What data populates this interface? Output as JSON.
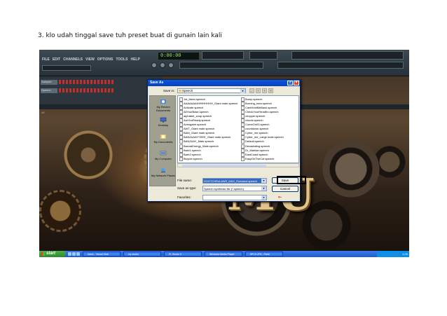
{
  "caption": "3. klo udah tinggal save tuh preset buat di gunain lain kali",
  "fl_studio": {
    "menu": [
      "FILE",
      "EDIT",
      "CHANNELS",
      "VIEW",
      "OPTIONS",
      "TOOLS",
      "HELP"
    ],
    "time_display": "0:00:00",
    "pattern_label": "Pattern 1",
    "channels": [
      "Sampler",
      "Speech"
    ],
    "browser_label": "All"
  },
  "dialog": {
    "title": "Save As",
    "save_in_label": "Save in:",
    "save_in_value": "Speech",
    "places": [
      "My Recent Documents",
      "Desktop",
      "My Documents",
      "My Computer",
      "My Network Places"
    ],
    "files_left": [
      "1st_listen.speech",
      "AAAAAAAHHHHHHHH_Giant male.speech",
      "Activate.speech",
      "AllYourBase.speech",
      "alphabet_soup.speech",
      "AreYouReady.speech",
      "Avengatre.speech",
      "AWT_Giant male.speech",
      "BAM_Giant male.speech",
      "BANZAAAYYEEE_Giant male.speech",
      "BANZAAY_Male.speech",
      "BanzaiEnergy_Male.speech",
      "Barb1.speech",
      "Barb2.speech",
      "Bicycle.speech"
    ],
    "files_right": [
      "Bump.speech",
      "Burning_ears.speech",
      "CantHoldMeBack.speech",
      "CheckYourHeadfro.speech",
      "chopper.speech",
      "clouds.speech",
      "ComeOn03.speech",
      "countdown.speech",
      "Cyber_me.speech",
      "Cyber_me_Large male.speech",
      "Default.speech",
      "Devastating.speech",
      "Dr_Martian.speech",
      "EastCoast.speech",
      "EasyOnTheCut.speech"
    ],
    "file_name_label": "File name:",
    "file_name_value": "DOOTCHEcLAWS_MAX_Robotool.speech",
    "save_as_type_label": "Save as type:",
    "save_as_type_value": "Speech synthesis file (*.speech)",
    "favorites_label": "Favorites:",
    "save_button": "Save",
    "cancel_button": "Cancel"
  },
  "taskbar": {
    "start": "start",
    "tasks": [
      "Inbox - Yahoo! Mail",
      "my studio",
      "FL Studio 9",
      "Windows Media Player",
      "8PC5.JPG - Paint"
    ],
    "clock": "1:05"
  },
  "wallpaper_text": "MU",
  "colors": {
    "titlebar": "#0a46c8",
    "taskbar": "#245edb",
    "selection": "#316ac5"
  }
}
